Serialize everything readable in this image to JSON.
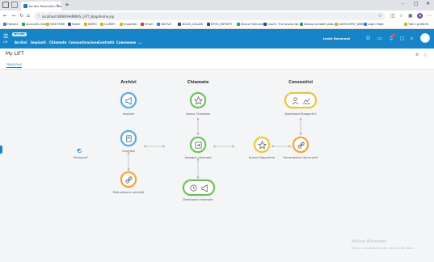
{
  "browser": {
    "tab_title": "Ad Hoc Revolution Web",
    "url": "localhost:8080/AHRWAS_LIFT_B/pp/home.jsp",
    "bookmarks": [
      "Fattoria",
      "Accounts Clienti",
      "GESTIONE",
      "Home",
      "DEMO",
      "CLIENTI",
      "Importati",
      "Email",
      "NUOVO",
      "AGGIS_SALARI",
      "EPOS_INFINITY",
      "Banca Fideuram",
      "Giunti: The Javascript...",
      "Debug variabili glob...",
      "ADHOCREV_WEB",
      "Login Page",
      "Tutti i preferiti"
    ]
  },
  "app": {
    "logo_text": "MY LIFT",
    "nav_small": "Lift",
    "menu": [
      "Archivi",
      "Impianti",
      "Chiamate",
      "Consuntivazione",
      "Contratti",
      "Commesse",
      "..."
    ],
    "user_name": "Jessie Bonanomi",
    "notification_count": "3"
  },
  "page": {
    "title": "My LIFT",
    "tab": "PRINCIPALE"
  },
  "flow": {
    "columns": [
      "Archivi",
      "Chiamate",
      "Consuntivi"
    ],
    "start_label": "Partiamo?",
    "nodes": {
      "impianti": "Impianti",
      "contratti": "Contratti",
      "fatturazione": "Fatturazione contratti",
      "nuova_chiamata": "Nuova Chiamata",
      "assegna": "Assegna chiamate",
      "dashboard_chiamate": "Dashboard chiamate",
      "dashboard_rapportini": "Dashboard Rapportini",
      "nuovo_rapportino": "Nuovo Rapportino",
      "generazione": "Generazione documenti"
    }
  },
  "os": {
    "watermark_title": "Attiva Windows",
    "watermark_sub": "Passa a Impostazioni per attivare Windows."
  },
  "colors": {
    "header": "#1684c7",
    "blue": "#5ba7dd",
    "green": "#6bbf5a",
    "orange": "#f2a23a",
    "yellow": "#e8c43a"
  }
}
